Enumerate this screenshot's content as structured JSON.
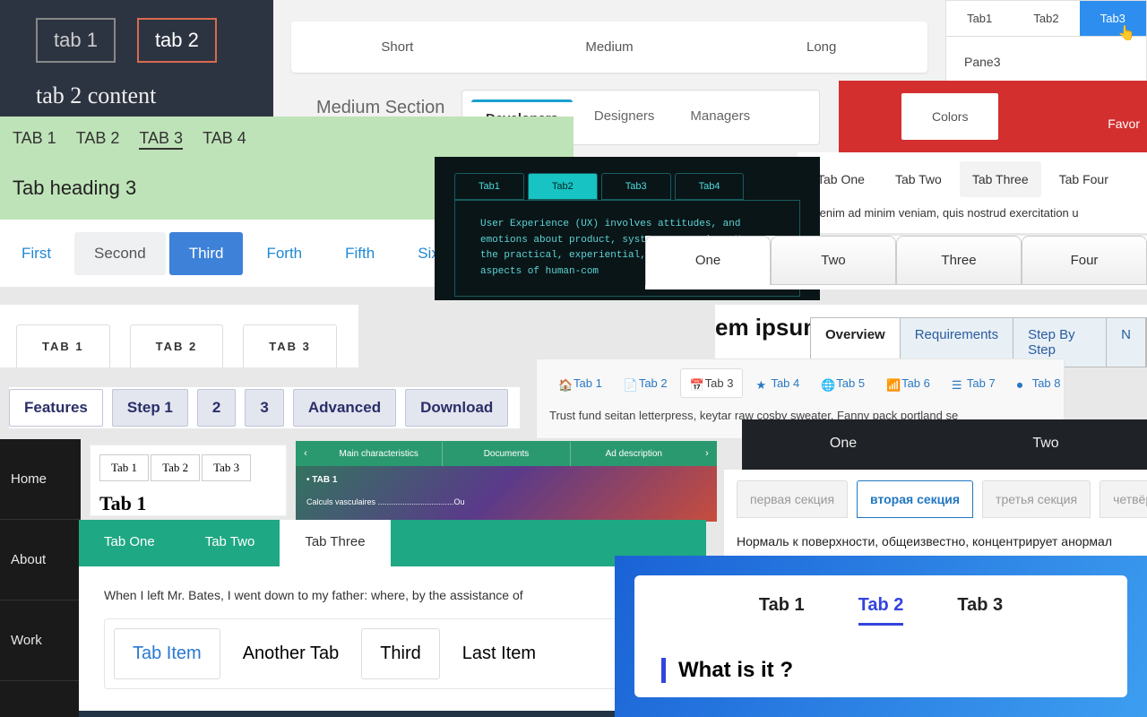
{
  "p1": {
    "tabs": [
      "tab 1",
      "tab 2"
    ],
    "active": 1,
    "content": "tab 2 content"
  },
  "p2": {
    "tabs": [
      "Short",
      "Medium",
      "Long"
    ],
    "title": "Medium Section",
    "sub": [
      "Developers",
      "Designers",
      "Managers"
    ],
    "sub_active": 0
  },
  "p3": {
    "tabs": [
      "Tab1",
      "Tab2",
      "Tab3"
    ],
    "active": 2,
    "content": "Pane3"
  },
  "pcolors": {
    "tab": "Colors",
    "other": "Favor"
  },
  "p4": {
    "tabs": [
      "Tab One",
      "Tab Two",
      "Tab Three",
      "Tab Four"
    ],
    "active": 2,
    "text": "Ut enim ad minim veniam, quis nostrud exercitation u"
  },
  "p5": {
    "tabs": [
      "TAB 1",
      "TAB 2",
      "TAB 3",
      "TAB 4"
    ],
    "active": 2,
    "heading": "Tab heading 3"
  },
  "p6": {
    "tabs": [
      "First",
      "Second",
      "Third",
      "Forth",
      "Fifth",
      "Sixth"
    ],
    "grey": 1,
    "blue": 2
  },
  "p7": {
    "tabs": [
      "Tab1",
      "Tab2",
      "Tab3",
      "Tab4"
    ],
    "active": 1,
    "text": "User Experience (UX) involves attitudes, and emotions about product, system or service. Use the practical, experiential, affec valuable aspects of human-com"
  },
  "p8": {
    "tabs": [
      "One",
      "Two",
      "Three",
      "Four"
    ],
    "active": 0
  },
  "p9": {
    "title": "em ipsum",
    "tabs": [
      "Overview",
      "Requirements",
      "Step By Step",
      "N"
    ],
    "active": 0
  },
  "p10": {
    "tabs": [
      "TAB 1",
      "TAB 2",
      "TAB 3"
    ]
  },
  "p11": {
    "tabs": [
      "Tab 1",
      "Tab 2",
      "Tab 3",
      "Tab 4",
      "Tab 5",
      "Tab 6",
      "Tab 7",
      "Tab 8"
    ],
    "active": 2,
    "icons": [
      "home",
      "file",
      "calendar",
      "star",
      "globe",
      "signal",
      "list",
      "record"
    ],
    "content": "Trust fund seitan letterpress, keytar raw\ncosby sweater. Fanny pack portland se"
  },
  "p12": {
    "tabs": [
      "Features",
      "Step 1",
      "2",
      "3",
      "Advanced",
      "Download"
    ],
    "active": 0
  },
  "p13": {
    "tabs": [
      "One",
      "Two"
    ]
  },
  "p14": {
    "tabs": [
      "Main characteristics",
      "Documents",
      "Ad description"
    ],
    "sub": "• TAB 1",
    "line": "Calculs vasculaires ..................................Ou"
  },
  "p15": {
    "items": [
      "Home",
      "About",
      "Work"
    ],
    "active": 1
  },
  "p16": {
    "tabs": [
      "Tab 1",
      "Tab 2",
      "Tab 3"
    ],
    "heading": "Tab 1"
  },
  "p17": {
    "tabs": [
      "первая секция",
      "вторая секция",
      "третья секция",
      "четвёрт"
    ],
    "active": 1,
    "text": "Нормаль к поверхности, общеизвестно, концентрирует анормал"
  },
  "p18": {
    "tabs": [
      "Tab One",
      "Tab Two",
      "Tab Three"
    ],
    "active": 2,
    "text": "When I left Mr. Bates, I went down to my father: where, by the assistance of",
    "inner": [
      "Tab Item",
      "Another Tab",
      "Third",
      "Last Item"
    ],
    "inner_active": 0
  },
  "p19": {
    "tabs": [
      "Tab 1",
      "Tab 2",
      "Tab 3"
    ],
    "active": 1,
    "heading": "What is it ?"
  }
}
